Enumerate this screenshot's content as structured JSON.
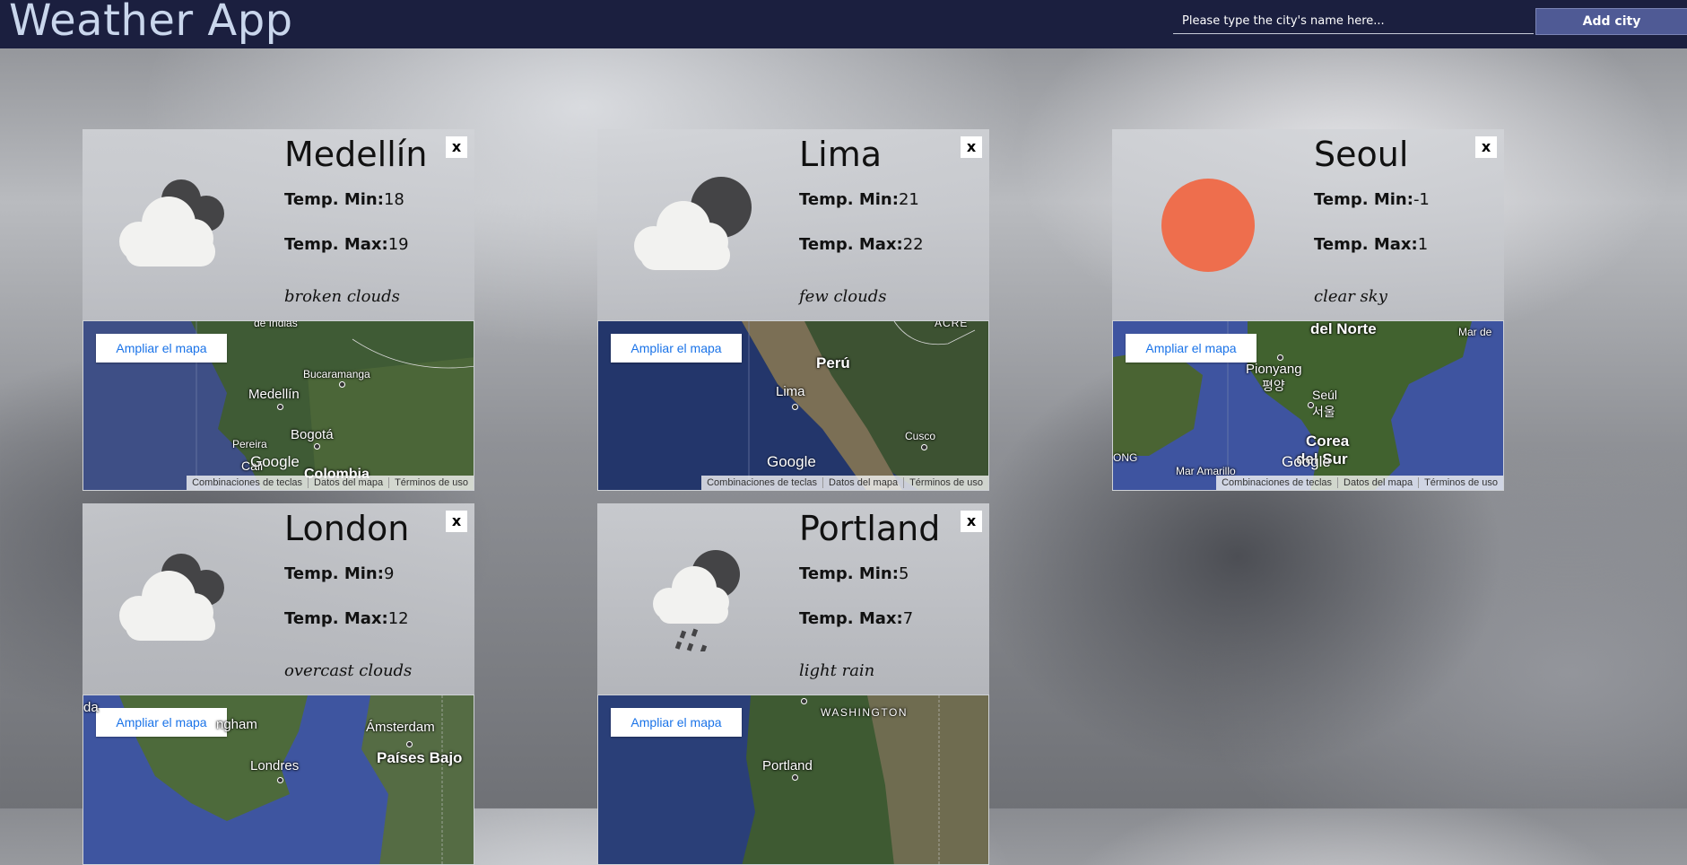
{
  "header": {
    "title": "Weather App",
    "search_placeholder": "Please type the city's name here...",
    "add_button": "Add city"
  },
  "common": {
    "temp_min_label": "Temp. Min:",
    "temp_max_label": "Temp. Max:",
    "close_label": "x",
    "map_button": "Ampliar el mapa",
    "google_label": "Google",
    "footer": [
      "Combinaciones de teclas",
      "Datos del mapa",
      "Términos de uso"
    ]
  },
  "cards": [
    {
      "city": "Medellín",
      "min": "18",
      "max": "19",
      "desc": "broken clouds",
      "icon": "broken-clouds-icon",
      "map_labels": [
        "de Indias",
        "Bucaramanga",
        "Medellín",
        "Bogotá",
        "Pereira",
        "Cali",
        "Colombia"
      ]
    },
    {
      "city": "Lima",
      "min": "21",
      "max": "22",
      "desc": "few clouds",
      "icon": "few-clouds-icon",
      "map_labels": [
        "ACRE",
        "Perú",
        "Lima",
        "Cusco"
      ]
    },
    {
      "city": "Seoul",
      "min": "-1",
      "max": "1",
      "desc": "clear sky",
      "icon": "sun-icon",
      "map_labels": [
        "del Norte",
        "Mar de",
        "Pionyang",
        "평양",
        "Seúl",
        "서울",
        "Corea",
        "del Sur",
        "Mar Amarillo",
        "ONG"
      ]
    },
    {
      "city": "London",
      "min": "9",
      "max": "12",
      "desc": "overcast clouds",
      "icon": "overcast-clouds-icon",
      "map_labels": [
        "da",
        "ngham",
        "Ámsterdam",
        "Londres",
        "Países Bajo"
      ]
    },
    {
      "city": "Portland",
      "min": "5",
      "max": "7",
      "desc": "light rain",
      "icon": "light-rain-icon",
      "map_labels": [
        "WASHINGTON",
        "Portland"
      ]
    }
  ],
  "colors": {
    "header_bg": "#1b1f3f",
    "title_color": "#c9d6ec",
    "add_button_bg": "#4f5a95",
    "sun": "#ee6e4d",
    "cloud_white": "#f2f2f0",
    "cloud_dark": "#444446"
  }
}
